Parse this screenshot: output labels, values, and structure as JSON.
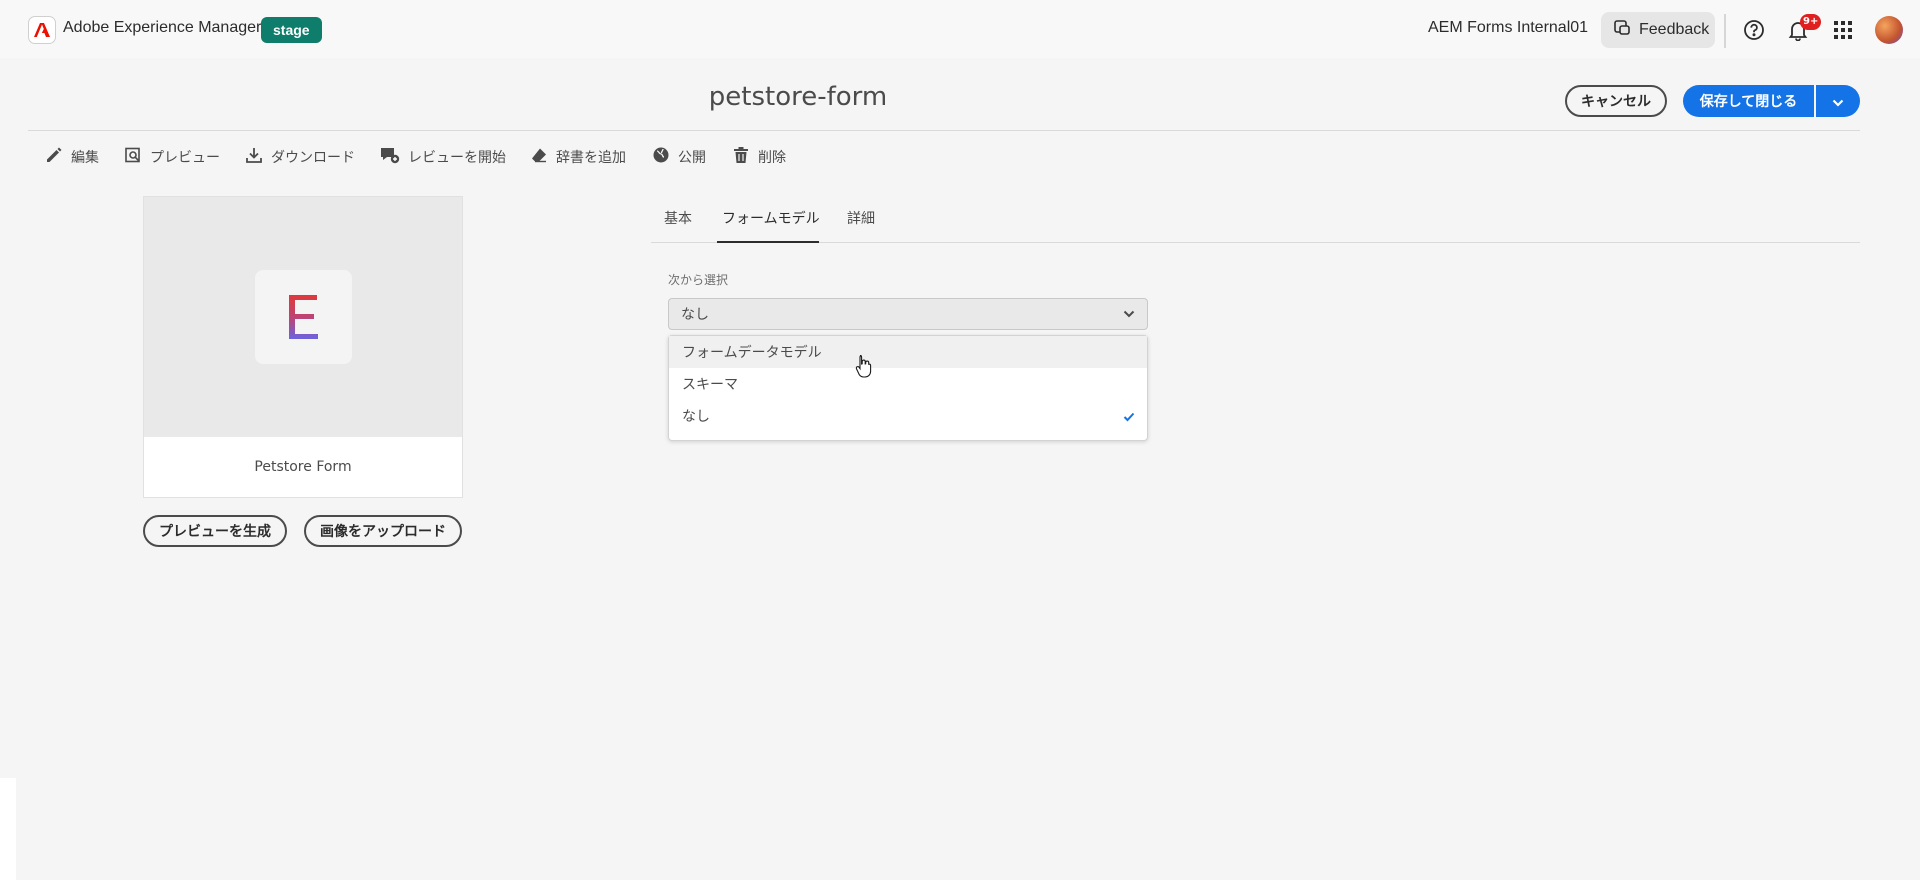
{
  "shell": {
    "app_name": "Adobe Experience Manager",
    "environment": "stage",
    "org_name": "AEM Forms Internal01",
    "feedback_label": "Feedback",
    "notification_count": "9+",
    "colors": {
      "environment_badge": "#0f7d6b",
      "accent": "#1473e6",
      "notification": "#e02020"
    }
  },
  "header": {
    "title": "petstore-form",
    "cancel_label": "キャンセル",
    "save_label": "保存して閉じる"
  },
  "actions": [
    {
      "label": "編集",
      "icon": "pencil-icon"
    },
    {
      "label": "プレビュー",
      "icon": "preview-icon"
    },
    {
      "label": "ダウンロード",
      "icon": "download-icon"
    },
    {
      "label": "レビューを開始",
      "icon": "review-icon"
    },
    {
      "label": "辞書を追加",
      "icon": "eraser-icon"
    },
    {
      "label": "公開",
      "icon": "globe-icon"
    },
    {
      "label": "削除",
      "icon": "trash-icon"
    }
  ],
  "card": {
    "thumbnail_letter": "E",
    "title": "Petstore Form",
    "generate_preview_label": "プレビューを生成",
    "upload_image_label": "画像をアップロード"
  },
  "tabs": [
    {
      "label": "基本",
      "active": false
    },
    {
      "label": "フォームモデル",
      "active": true
    },
    {
      "label": "詳細",
      "active": false
    }
  ],
  "form_model": {
    "select_label": "次から選択",
    "selected_value": "なし",
    "options": [
      {
        "label": "フォームデータモデル",
        "hovered": true,
        "selected": false
      },
      {
        "label": "スキーマ",
        "hovered": false,
        "selected": false
      },
      {
        "label": "なし",
        "hovered": false,
        "selected": true
      }
    ]
  }
}
